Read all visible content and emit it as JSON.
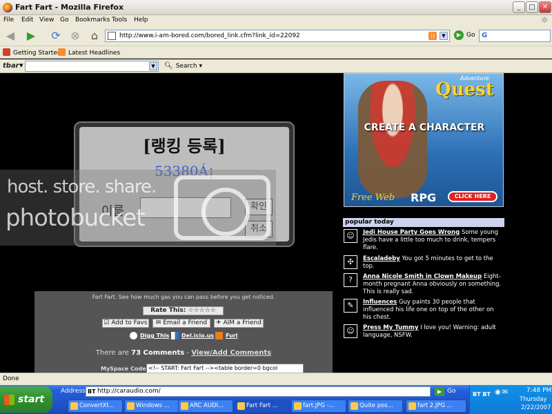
{
  "window": {
    "title": "Fart Fart - Mozilla Firefox",
    "controls": [
      "_",
      "□",
      "✕"
    ]
  },
  "menu": [
    "File",
    "Edit",
    "View",
    "Go",
    "Bookmarks",
    "Tools",
    "Help"
  ],
  "nav": {
    "url": "http://www.i-am-bored.com/bored_link.cfm?link_id=22092",
    "go_label": "Go"
  },
  "bookmarks": [
    "Getting Started",
    "Latest Headlines"
  ],
  "toolbar": {
    "logo": "tbar",
    "search_label": "Search"
  },
  "game": {
    "title": "[랭킹 등록]",
    "score": "53380Á¡",
    "name_label": "이름",
    "confirm_label": "확인",
    "cancel_label": "취소"
  },
  "watermark": {
    "line1": "host. store. share.",
    "line2": "photobucket"
  },
  "page": {
    "description": "Fart Fart. See how much gas you can pass before you get noticed.",
    "rate_label": "Rate This: ☆☆☆☆☆",
    "add_favs": "☑ Add to Favs",
    "email_friend": "✉ Email a Friend",
    "aim_friend": "AIM a Friend",
    "digg": "Digg This",
    "delicious": "Del.icio.us",
    "furl": "Furl",
    "comments_prefix": "There are",
    "comments_count": "73 Comments",
    "comments_sep": "-",
    "comments_link": "View/Add Comments",
    "myspace_label": "MySpace Code:",
    "myspace_code": "<!-- START: Fart Fart --><table border=0 bgcol"
  },
  "ad": {
    "adventure": "Adventure",
    "quest": "Quest",
    "create": "CREATE A CHARACTER",
    "freeweb": "Free Web",
    "rpg": "RPG",
    "click": "CLICK HERE"
  },
  "popular": {
    "header": "popular today",
    "items": [
      {
        "icon": "smiley",
        "title": "Jedi House Party Goes Wrong",
        "text": " Some young Jedis have a little too much to drink, tempers flare."
      },
      {
        "icon": "puzzle",
        "title": "Escaladeby",
        "text": " You got 5 minutes to get to the top."
      },
      {
        "icon": "question",
        "title": "Anna Nicole Smith in Clown Makeup",
        "text": " Eight-month pregnant Anna obviously on something. This is really sad."
      },
      {
        "icon": "brush",
        "title": "Influences",
        "text": " Guy paints 30 people that influenced his life one on top of the other on his chest."
      },
      {
        "icon": "smiley",
        "title": "Press My Tummy",
        "text": " I love you! Warning: adult language, NSFW."
      }
    ]
  },
  "status": "Done",
  "taskbar": {
    "start": "start",
    "address_label": "Address",
    "address_value": "http://caraudio.com/",
    "address_prefix": "BT",
    "go_label": "Go",
    "tasks": [
      "ConvertXt...",
      "Windows ...",
      "ARC AUDI...",
      "Fart Fart ...",
      "fart.JPG -...",
      "Quite pos...",
      "fart 2.JPG ..."
    ],
    "tray_bt": "BT BT",
    "time": "7:48 PM",
    "day": "Thursday",
    "date": "2/22/2007"
  },
  "colors": {
    "accent": "#245edb",
    "start_green": "#2f8f2f",
    "popular_header": "#cdd3ef"
  }
}
